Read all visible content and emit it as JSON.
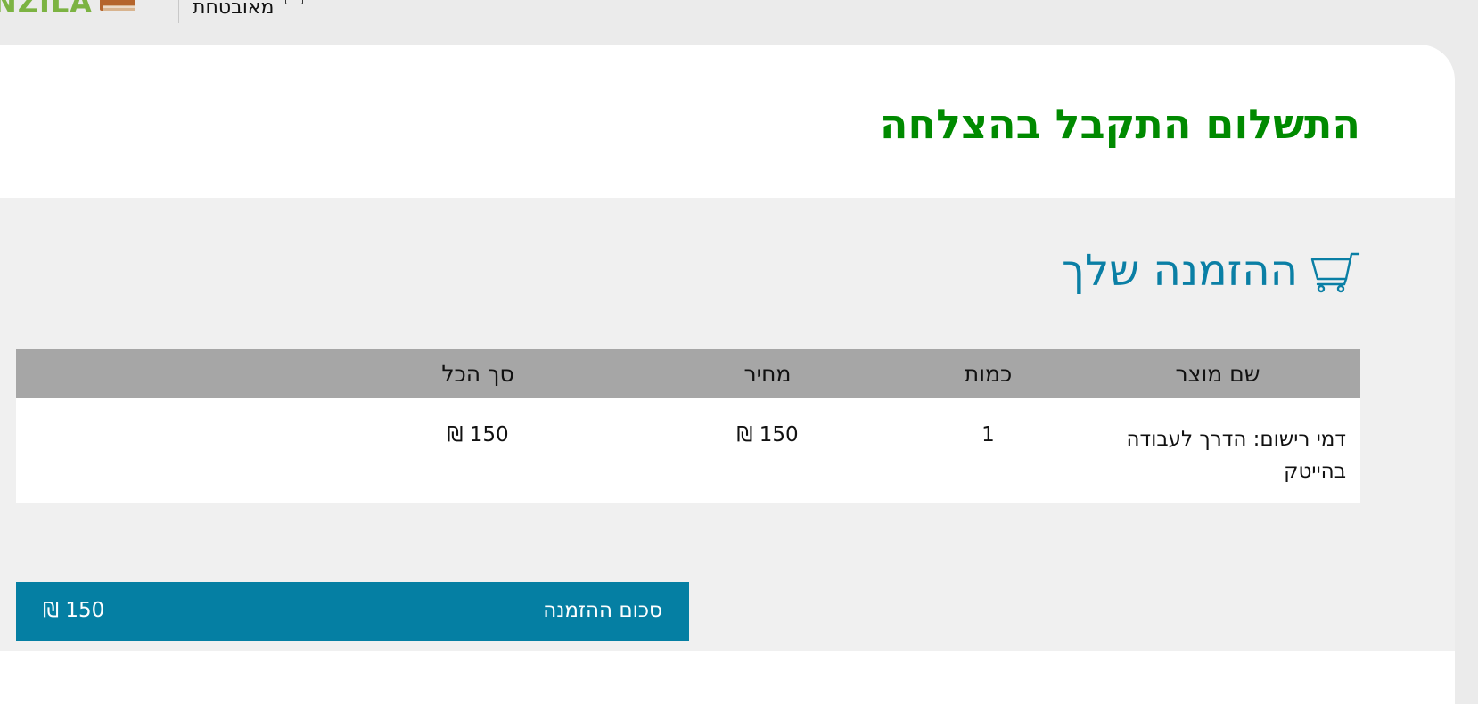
{
  "header": {
    "logo_text": "NZILA",
    "nav_link": "מאובטחת",
    "logo_icon": "book-icon",
    "nav_icon": "box-icon"
  },
  "page": {
    "success_title": "התשלום התקבל בהצלחה"
  },
  "order": {
    "heading": "ההזמנה שלך",
    "heading_icon": "shopping-cart-icon",
    "columns": {
      "name": "שם מוצר",
      "quantity": "כמות",
      "price": "מחיר",
      "total": "סך הכל"
    },
    "items": [
      {
        "name": "דמי רישום: הדרך לעבודה בהייטק",
        "quantity": "1",
        "price": "150 ₪",
        "total": "150 ₪"
      }
    ],
    "summary": {
      "label": "סכום ההזמנה",
      "value": "150 ₪"
    }
  },
  "colors": {
    "success": "#008a00",
    "accent": "#057fa3",
    "heading": "#0a7fa5",
    "table_header": "#a6a6a6"
  }
}
